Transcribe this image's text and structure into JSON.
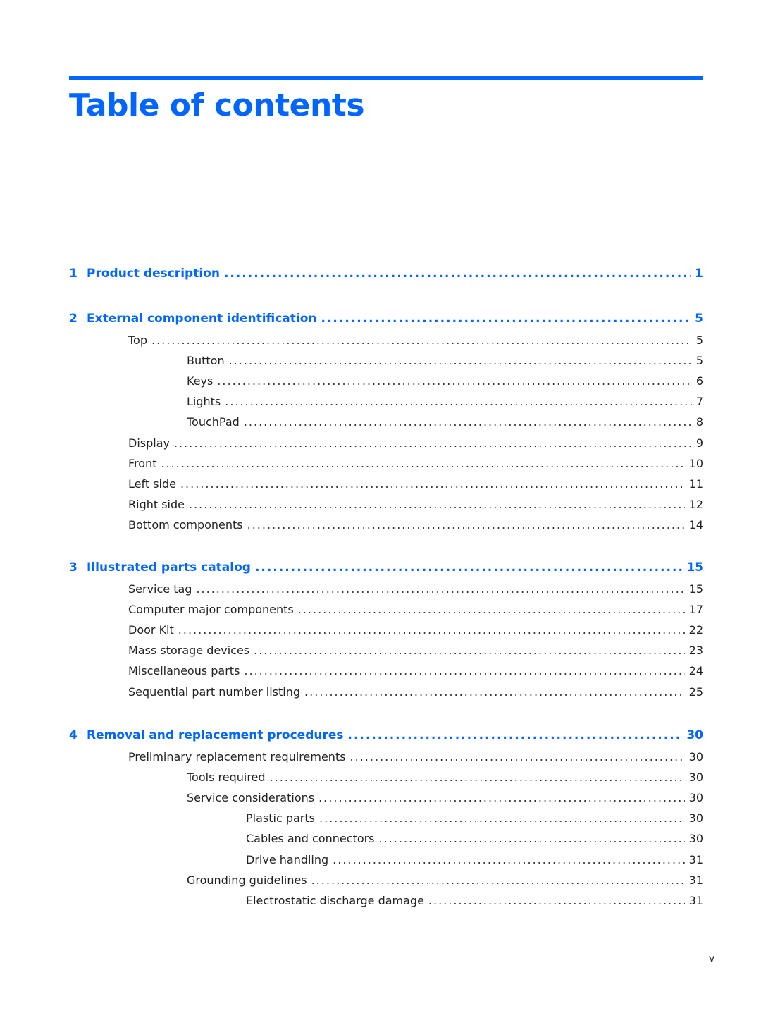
{
  "document": {
    "title": "Table of contents",
    "page_number": "v",
    "accent_color": "#0066ff"
  },
  "chapters": [
    {
      "number": "1",
      "title": "Product description",
      "page": "1",
      "entries": []
    },
    {
      "number": "2",
      "title": "External component identification",
      "page": "5",
      "entries": [
        {
          "level": 1,
          "title": "Top",
          "page": "5"
        },
        {
          "level": 2,
          "title": "Button",
          "page": "5"
        },
        {
          "level": 2,
          "title": "Keys",
          "page": "6"
        },
        {
          "level": 2,
          "title": "Lights",
          "page": "7"
        },
        {
          "level": 2,
          "title": "TouchPad",
          "page": "8"
        },
        {
          "level": 1,
          "title": "Display",
          "page": "9"
        },
        {
          "level": 1,
          "title": "Front",
          "page": "10"
        },
        {
          "level": 1,
          "title": "Left side",
          "page": "11"
        },
        {
          "level": 1,
          "title": "Right side",
          "page": "12"
        },
        {
          "level": 1,
          "title": "Bottom components",
          "page": "14"
        }
      ]
    },
    {
      "number": "3",
      "title": "Illustrated parts catalog",
      "page": "15",
      "entries": [
        {
          "level": 1,
          "title": "Service tag",
          "page": "15"
        },
        {
          "level": 1,
          "title": "Computer major components",
          "page": "17"
        },
        {
          "level": 1,
          "title": "Door Kit",
          "page": "22"
        },
        {
          "level": 1,
          "title": "Mass storage devices",
          "page": "23"
        },
        {
          "level": 1,
          "title": "Miscellaneous parts",
          "page": "24"
        },
        {
          "level": 1,
          "title": "Sequential part number listing",
          "page": "25"
        }
      ]
    },
    {
      "number": "4",
      "title": "Removal and replacement procedures",
      "page": "30",
      "entries": [
        {
          "level": 1,
          "title": "Preliminary replacement requirements",
          "page": "30"
        },
        {
          "level": 2,
          "title": "Tools required",
          "page": "30"
        },
        {
          "level": 2,
          "title": "Service considerations",
          "page": "30"
        },
        {
          "level": 3,
          "title": "Plastic parts",
          "page": "30"
        },
        {
          "level": 3,
          "title": "Cables and connectors",
          "page": "30"
        },
        {
          "level": 3,
          "title": "Drive handling",
          "page": "31"
        },
        {
          "level": 2,
          "title": "Grounding guidelines",
          "page": "31"
        },
        {
          "level": 3,
          "title": "Electrostatic discharge damage",
          "page": "31"
        }
      ]
    }
  ]
}
